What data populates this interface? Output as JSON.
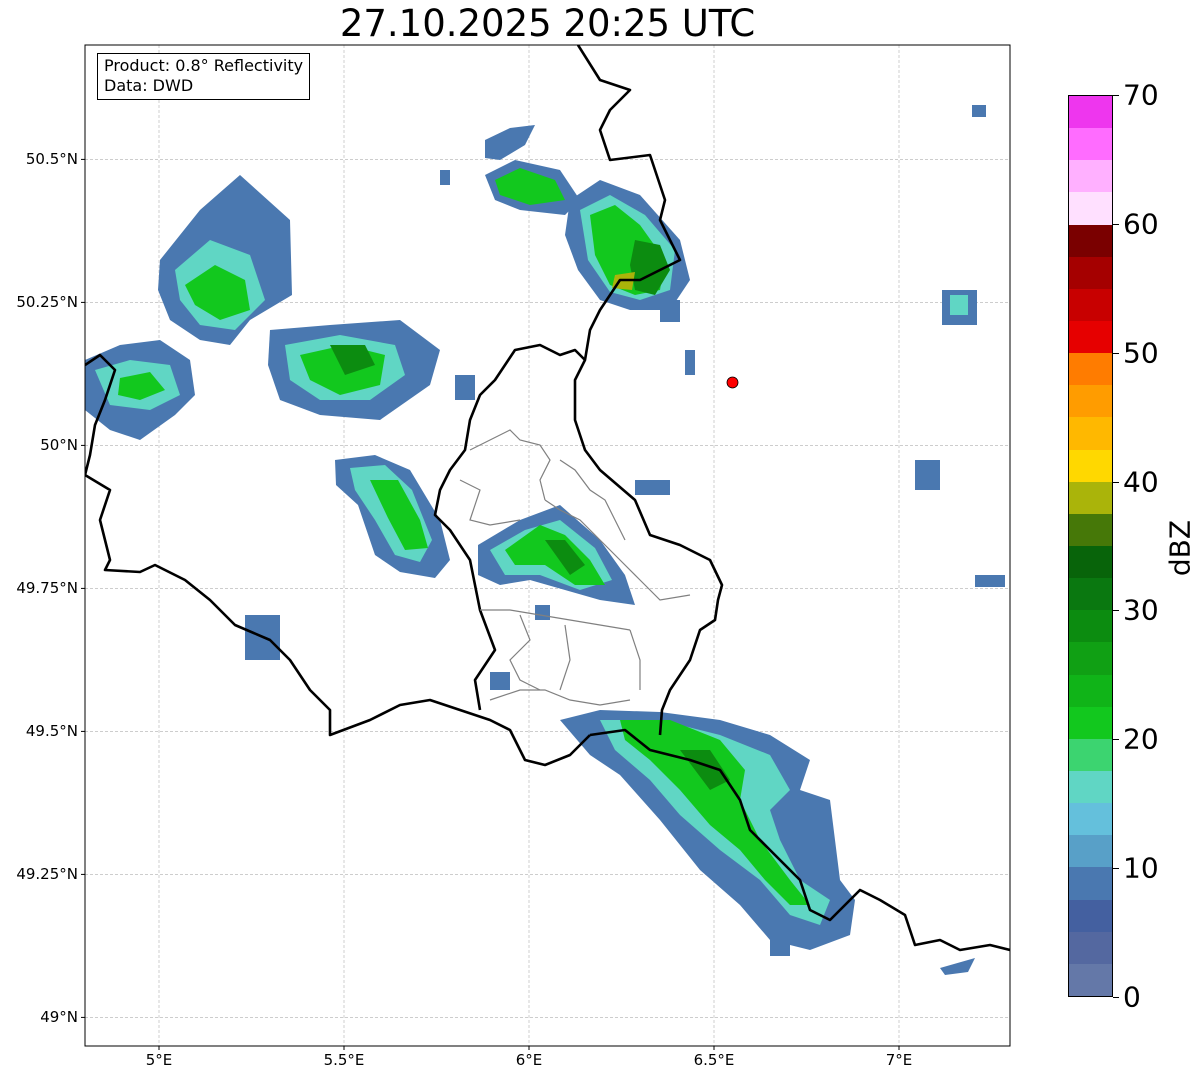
{
  "title": "27.10.2025 20:25 UTC",
  "info": {
    "product": "Product: 0.8° Reflectivity",
    "source": "Data: DWD"
  },
  "axes": {
    "lon_range": [
      4.8,
      7.3
    ],
    "lat_range": [
      48.95,
      50.7
    ],
    "x_ticks": [
      {
        "value": 5.0,
        "label": "5°E"
      },
      {
        "value": 5.5,
        "label": "5.5°E"
      },
      {
        "value": 6.0,
        "label": "6°E"
      },
      {
        "value": 6.5,
        "label": "6.5°E"
      },
      {
        "value": 7.0,
        "label": "7°E"
      }
    ],
    "y_ticks": [
      {
        "value": 49.0,
        "label": "49°N"
      },
      {
        "value": 49.25,
        "label": "49.25°N"
      },
      {
        "value": 49.5,
        "label": "49.5°N"
      },
      {
        "value": 49.75,
        "label": "49.75°N"
      },
      {
        "value": 50.0,
        "label": "50°N"
      },
      {
        "value": 50.25,
        "label": "50.25°N"
      },
      {
        "value": 50.5,
        "label": "50.5°N"
      }
    ],
    "grid": true
  },
  "radar_site": {
    "lon": 6.55,
    "lat": 50.11,
    "color": "#ff0000"
  },
  "colorbar": {
    "label": "dBZ",
    "min": 0,
    "max": 70,
    "ticks": [
      {
        "value": 0,
        "label": "0"
      },
      {
        "value": 10,
        "label": "10"
      },
      {
        "value": 20,
        "label": "20"
      },
      {
        "value": 30,
        "label": "30"
      },
      {
        "value": 40,
        "label": "40"
      },
      {
        "value": 50,
        "label": "50"
      },
      {
        "value": 60,
        "label": "60"
      },
      {
        "value": 70,
        "label": "70"
      }
    ],
    "colors": [
      "#6478a8",
      "#5468a0",
      "#4460a0",
      "#4a78b0",
      "#58a0c8",
      "#64c0dc",
      "#60d6c4",
      "#3cd470",
      "#12c81e",
      "#10b418",
      "#10a014",
      "#0c8c10",
      "#0a7810",
      "#08640a",
      "#467808",
      "#aab40a",
      "#ffd800",
      "#ffb800",
      "#ff9c00",
      "#ff7c00",
      "#e60000",
      "#c80000",
      "#a50000",
      "#7a0000",
      "#ffe0ff",
      "#ffb0ff",
      "#ff6cff",
      "#ee36ee"
    ]
  }
}
